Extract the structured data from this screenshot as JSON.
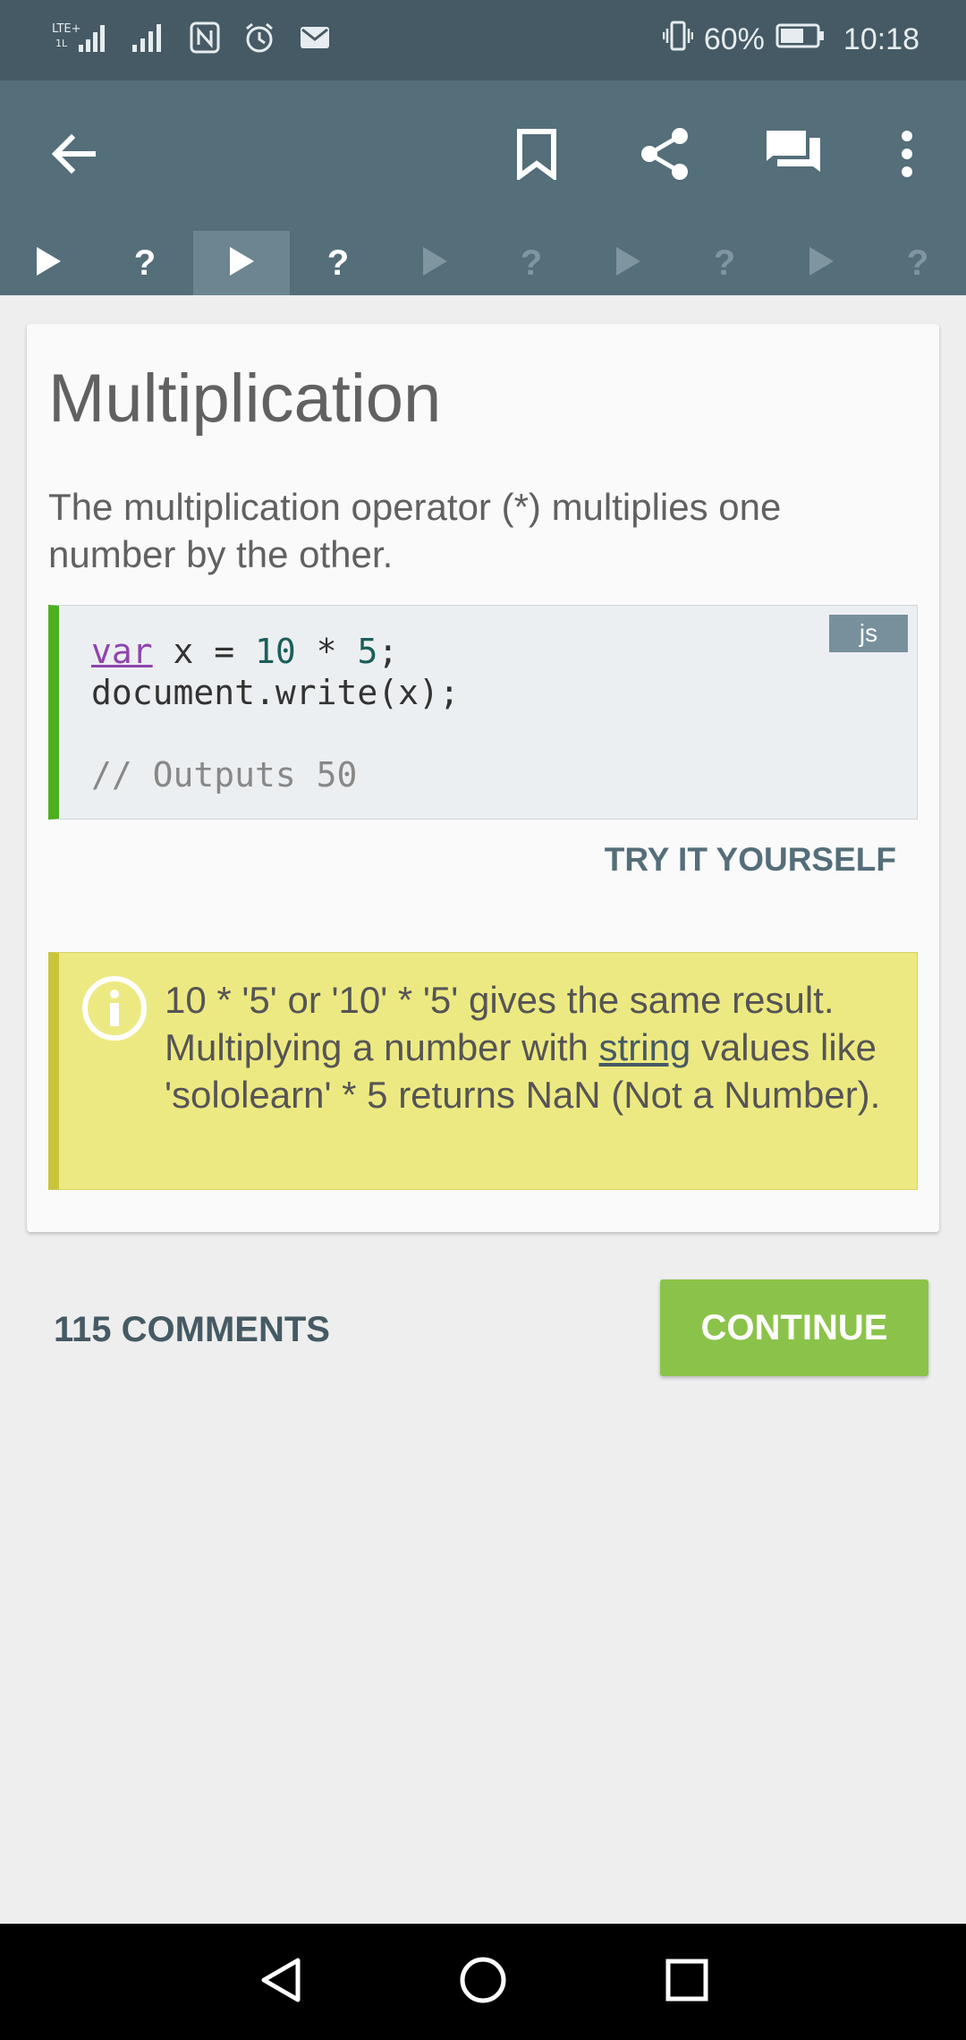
{
  "status_bar": {
    "carrier_icon": "lte-signal-icon",
    "battery_percent": "60%",
    "time": "10:18"
  },
  "app_bar": {
    "icons": [
      "back-arrow-icon",
      "bookmark-icon",
      "share-icon",
      "comments-icon",
      "more-vert-icon"
    ]
  },
  "lesson_steps": [
    {
      "type": "play",
      "state": "done"
    },
    {
      "type": "quiz",
      "state": "done"
    },
    {
      "type": "play",
      "state": "current"
    },
    {
      "type": "quiz",
      "state": "todo"
    },
    {
      "type": "play",
      "state": "todo"
    },
    {
      "type": "quiz",
      "state": "todo"
    },
    {
      "type": "play",
      "state": "todo"
    },
    {
      "type": "quiz",
      "state": "todo"
    },
    {
      "type": "play",
      "state": "todo"
    },
    {
      "type": "quiz",
      "state": "todo"
    }
  ],
  "lesson": {
    "title": "Multiplication",
    "description": "The multiplication operator (*) multiplies one number by the other.",
    "code": {
      "language": "js",
      "keyword": "var",
      "line1_rest_a": " x = ",
      "num1": "10",
      "op": " * ",
      "num2": "5",
      "semi": ";",
      "line2": "document.write(x);",
      "comment": "// Outputs 50"
    },
    "try_label": "TRY IT YOURSELF",
    "note": {
      "part1": "10 * '5' or '10' * '5' gives the same result. Multiplying a number with ",
      "link": "string",
      "part2": " values like 'sololearn' * 5 returns NaN (Not a Number)."
    }
  },
  "footer": {
    "comments_label": "115 COMMENTS",
    "continue_label": "CONTINUE"
  },
  "colors": {
    "status_bar": "#455a64",
    "app_bar": "#546e7a",
    "accent_green": "#8bc34a",
    "code_border": "#4caf1f",
    "note_bg": "#ede982"
  }
}
